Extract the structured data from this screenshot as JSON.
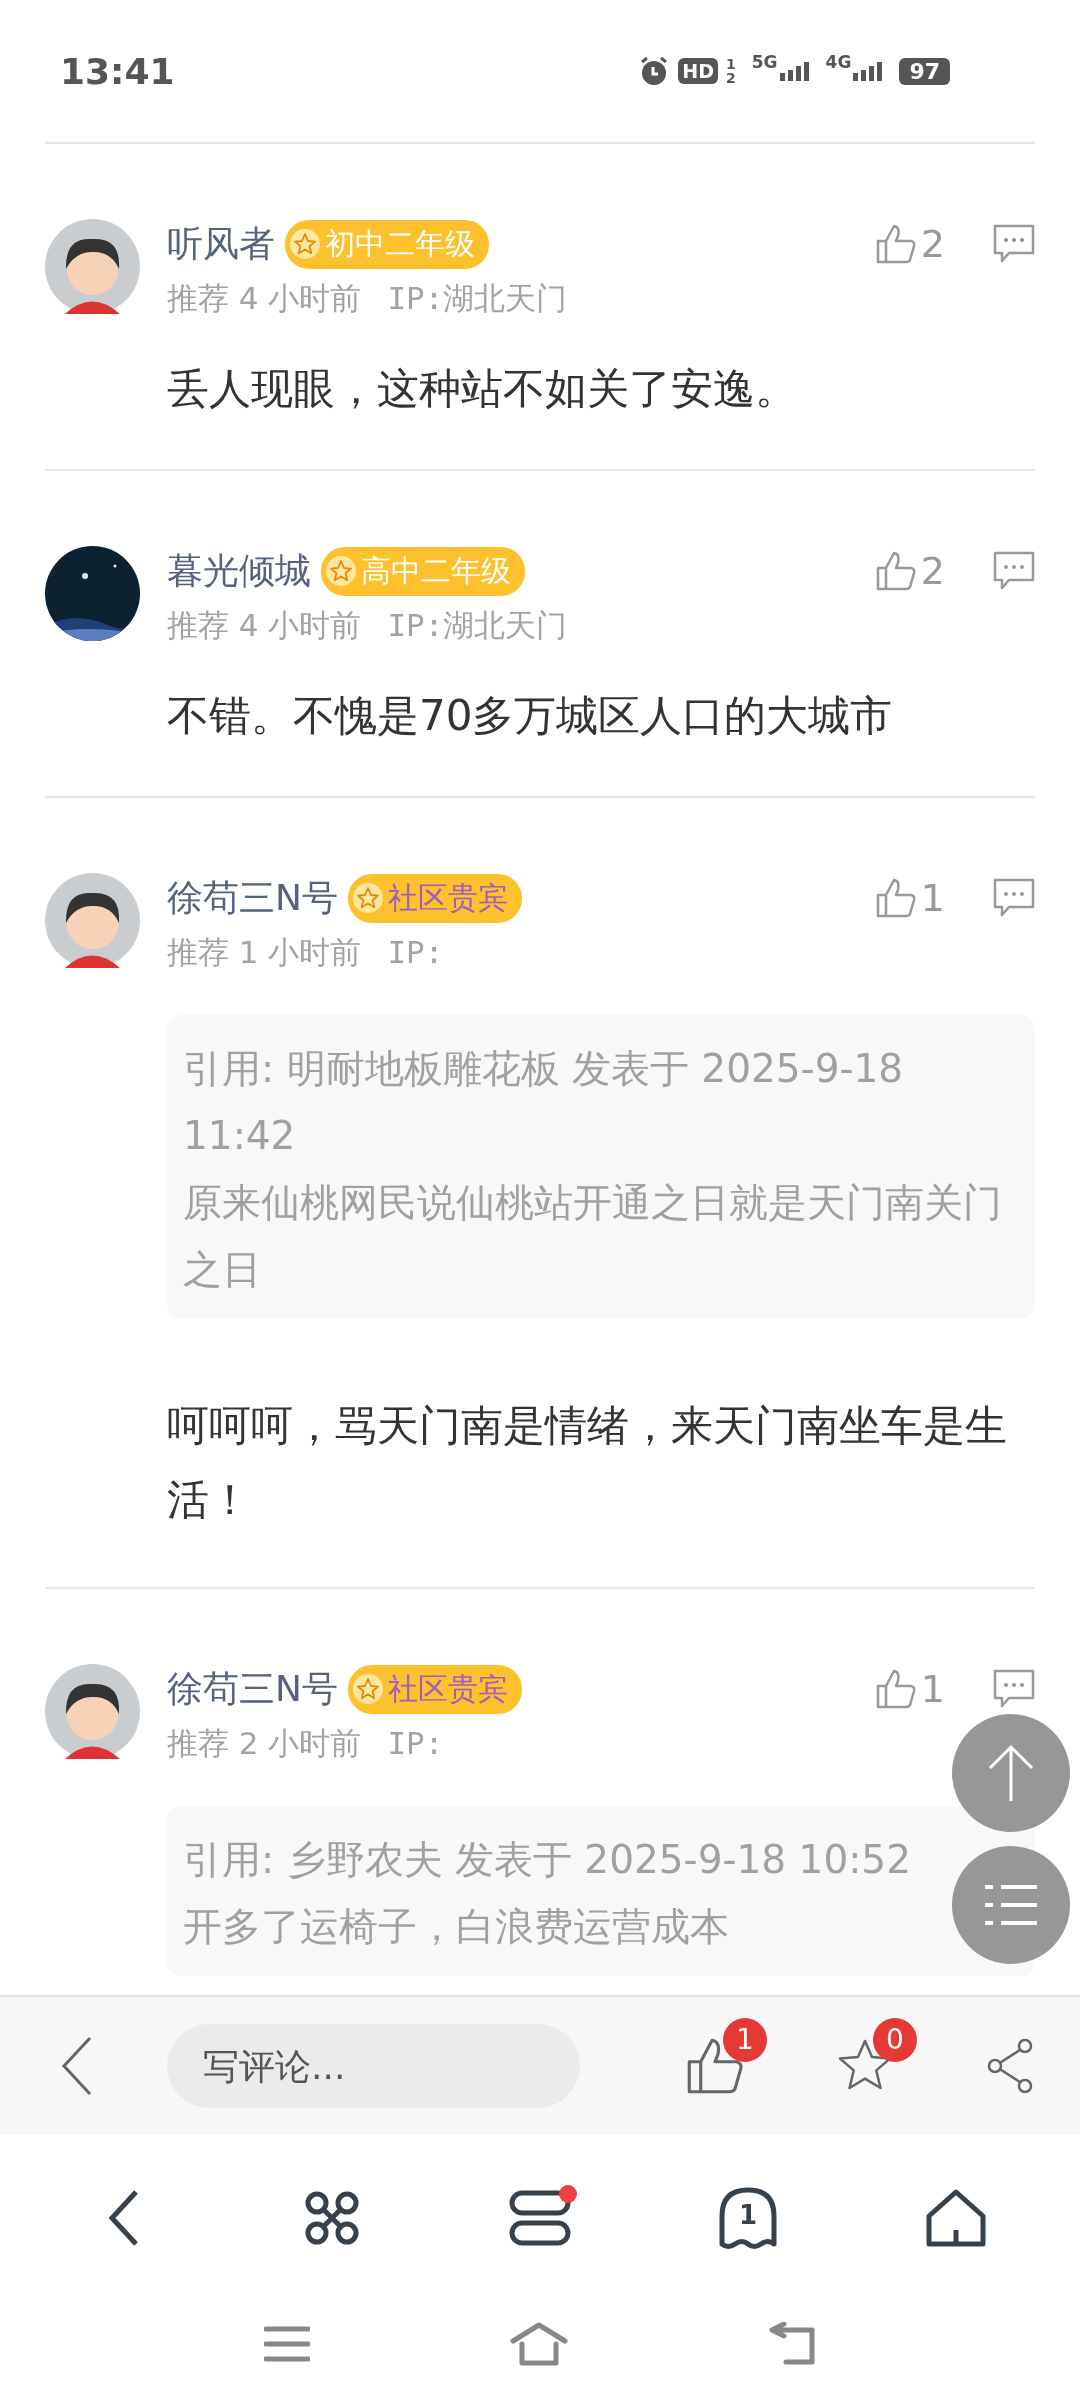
{
  "status_bar": {
    "time": "13:41",
    "hd_label": "HD",
    "sim_labels": [
      "1",
      "2"
    ],
    "network_1": "5G",
    "network_2": "4G",
    "battery": "97"
  },
  "comments": [
    {
      "avatar": {
        "kind": "figure"
      },
      "name": "听风者",
      "badge": {
        "text": "初中二年级",
        "kind": "grade"
      },
      "time": "推荐 4 小时前",
      "ip": "IP:湖北天门",
      "likes": "2",
      "body": "丢人现眼，这种站不如关了安逸。"
    },
    {
      "name": "暮光倾城",
      "badge": {
        "text": "高中二年级",
        "kind": "grade"
      },
      "time": "推荐 4 小时前",
      "ip": "IP:湖北天门",
      "likes": "2",
      "body": "不错。不愧是70多万城区人口的大城市"
    },
    {
      "avatar": {
        "kind": "figure"
      },
      "name": "徐苟三N号",
      "badge": {
        "text": "社区贵宾",
        "kind": "guest"
      },
      "time": "推荐 1 小时前",
      "ip": "IP:",
      "likes": "1",
      "quote": {
        "header": "引用: 明耐地板雕花板 发表于 2025-9-18 11:42",
        "text": "原来仙桃网民说仙桃站开通之日就是天门南关门之日"
      },
      "body": "呵呵呵，骂天门南是情绪，来天门南坐车是生活！"
    },
    {
      "avatar": {
        "kind": "figure"
      },
      "name": "徐苟三N号",
      "badge": {
        "text": "社区贵宾",
        "kind": "guest"
      },
      "time": "推荐 2 小时前",
      "ip": "IP:",
      "likes": "1",
      "quote": {
        "header": "引用: 乡野农夫 发表于 2025-9-18 10:52",
        "text": "开多了运椅子，白浪费运营成本"
      }
    }
  ],
  "comment_bar": {
    "placeholder": "写评论...",
    "like_count": "1",
    "favorite_count": "0"
  },
  "browser_nav": {
    "tab_count": "1",
    "menu_dot": true
  }
}
